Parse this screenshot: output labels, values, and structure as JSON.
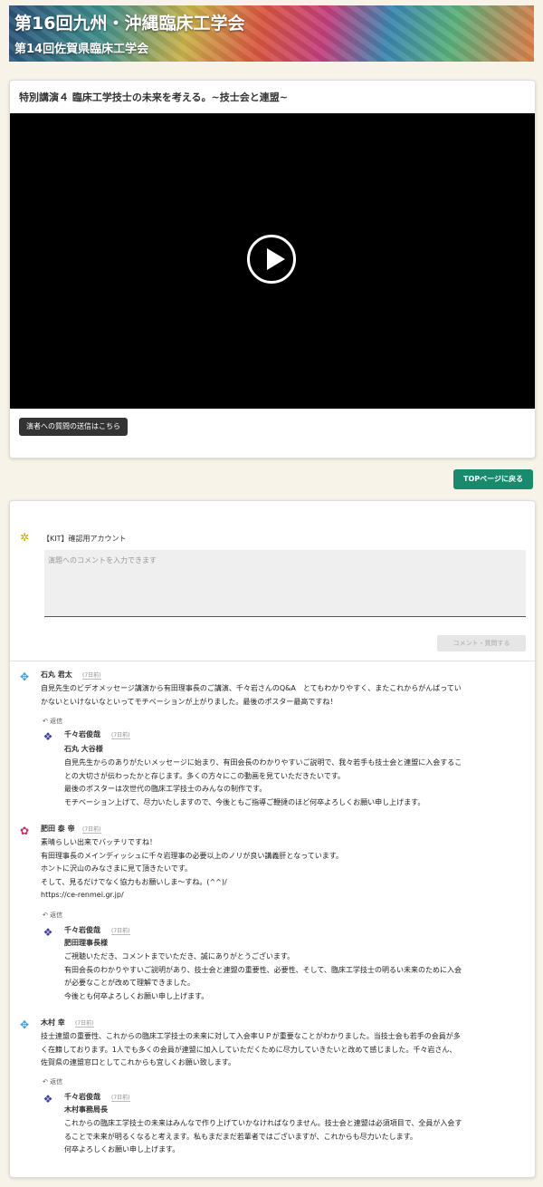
{
  "banner": {
    "title": "第16回九州・沖縄臨床工学会",
    "subtitle": "第14回佐賀県臨床工学会"
  },
  "video": {
    "title": "特別講演４ 臨床工学技士の未来を考える。~技士会と連盟~",
    "poll_button": "演者への質問の送信はこちら"
  },
  "top_button": "TOPページに戻る",
  "comment_form": {
    "account": "【KIT】確認用アカウント",
    "placeholder": "演題へのコメントを入力できます",
    "submit": "コメント・質問する"
  },
  "comments": [
    {
      "name": "石丸 君太",
      "time": "(7日前)",
      "lines": [
        "自見先生のビデオメッセージ講演から有田理事長のご講演、千々岩さんのQ&A　とてもわかりやすく、またこれからがんばってい",
        "かないといけないなといってモチベーションが上がりました。最後のポスター最高ですね！"
      ],
      "reply_label": "返信",
      "reply": {
        "name": "千々岩俊哉",
        "time": "(7日前)",
        "to": "石丸 大谷様",
        "lines": [
          "自見先生からのありがたいメッセージに始まり、有田会長のわかりやすいご説明で、我々若手も技士会と連盟に入会するこ",
          "との大切さが伝わったかと存じます。多くの方々にこの動画を見ていただきたいです。",
          "最後のポスターは次世代の臨床工学技士のみんなの制作です。",
          "モチベーション上げて、尽力いたしますので、今後ともご指導ご鞭撻のほど何卒よろしくお願い申し上げます。"
        ]
      }
    },
    {
      "name": "肥田 泰 帝",
      "time": "(7日前)",
      "lines": [
        "素晴らしい出来でバッチリですね！",
        "有田理事長のメインディッシュに千々岩理事の必要以上のノリが良い講義肝となっています。",
        "ホントに沢山のみなさまに見て頂きたいです。",
        "そして、見るだけでなく協力もお願いしま～すね。(^^)/",
        "https://ce-renmei.gr.jp/"
      ],
      "reply_label": "返信",
      "reply": {
        "name": "千々岩俊哉",
        "time": "(7日前)",
        "to": "肥田理事長様",
        "lines": [
          "ご視聴いただき、コメントまでいただき、誠にありがとうございます。",
          "有田会長のわかりやすいご説明があり、技士会と連盟の重要性、必要性、そして、臨床工学技士の明るい未来のために入会",
          "が必要なことが改めて理解できました。",
          "今後とも何卒よろしくお願い申し上げます。"
        ]
      }
    },
    {
      "name": "木村 幸",
      "time": "(7日前)",
      "lines": [
        "技士連盟の重要性、これからの臨床工学技士の未来に対して入会率ＵＰが重要なことがわかりました。当技士会も若手の会員が多",
        "く在籍しております。1人でも多くの会員が連盟に加入していただくために尽力していきたいと改めて感じました。千々岩さん、",
        "佐賀県の連盟窓口としてこれからも宜しくお願い致します。"
      ],
      "reply_label": "返信",
      "reply": {
        "name": "千々岩俊哉",
        "time": "(7日前)",
        "to": "木村事務局長",
        "lines": [
          "これからの臨床工学技士の未来はみんなで作り上げていかなければなりません。技士会と連盟は必須項目で、全員が入会す",
          "ることで未来が明るくなると考えます。私もまだまだ若輩者ではございますが、これからも尽力いたします。",
          "何卒よろしくお願い申し上げます。"
        ]
      }
    }
  ]
}
